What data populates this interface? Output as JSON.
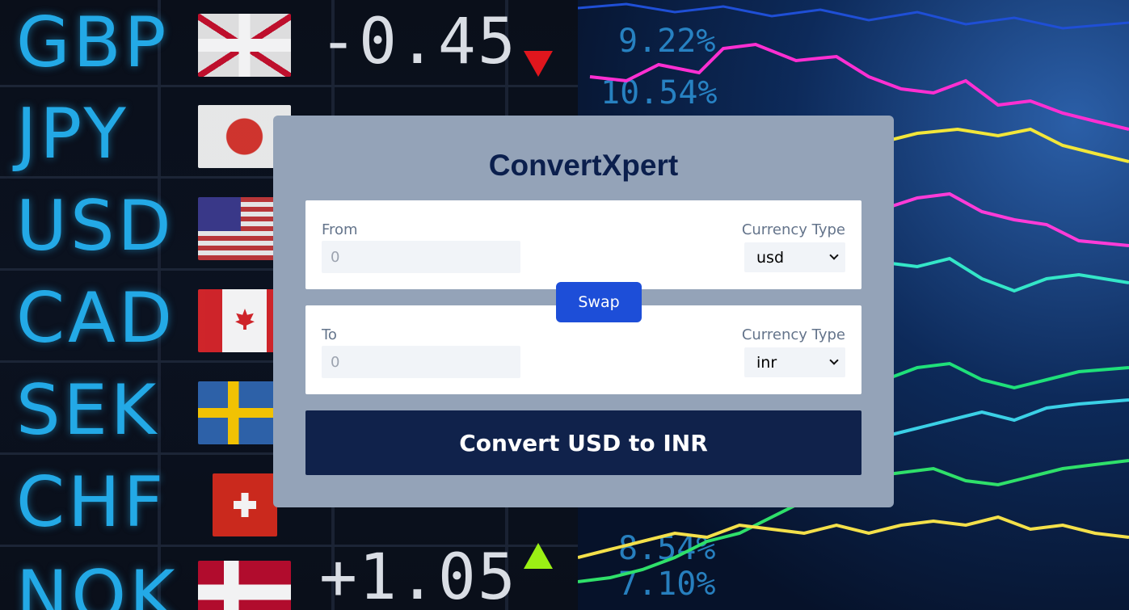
{
  "background": {
    "tickers": [
      {
        "code": "GBP",
        "change": "-0.45",
        "flag": "uk-flag"
      },
      {
        "code": "JPY",
        "change": "",
        "flag": "japan-flag"
      },
      {
        "code": "USD",
        "change": "",
        "flag": "usa-flag"
      },
      {
        "code": "CAD",
        "change": "",
        "flag": "canada-flag"
      },
      {
        "code": "SEK",
        "change": "",
        "flag": "sweden-flag"
      },
      {
        "code": "CHF",
        "change": "",
        "flag": "switzerland-flag"
      },
      {
        "code": "NOK",
        "change": "+1.05",
        "flag": "norway-flag"
      }
    ],
    "chart_percents": [
      "9.22%",
      "10.54%",
      "8.54%",
      "7.10%"
    ],
    "colors": {
      "ticker_code": "#23a9e6",
      "down_arrow": "#e0161d",
      "up_arrow": "#9bf014"
    }
  },
  "app": {
    "title": "ConvertXpert",
    "from": {
      "label": "From",
      "amount_placeholder": "0",
      "currency_label": "Currency Type",
      "currency_value": "usd"
    },
    "swap_label": "Swap",
    "to": {
      "label": "To",
      "amount_placeholder": "0",
      "currency_label": "Currency Type",
      "currency_value": "inr"
    },
    "convert_label": "Convert USD to INR",
    "colors": {
      "card": "#94a3b8",
      "title": "#0b1f4d",
      "swap_button": "#1d4ed8",
      "convert_button": "#10224b"
    }
  }
}
